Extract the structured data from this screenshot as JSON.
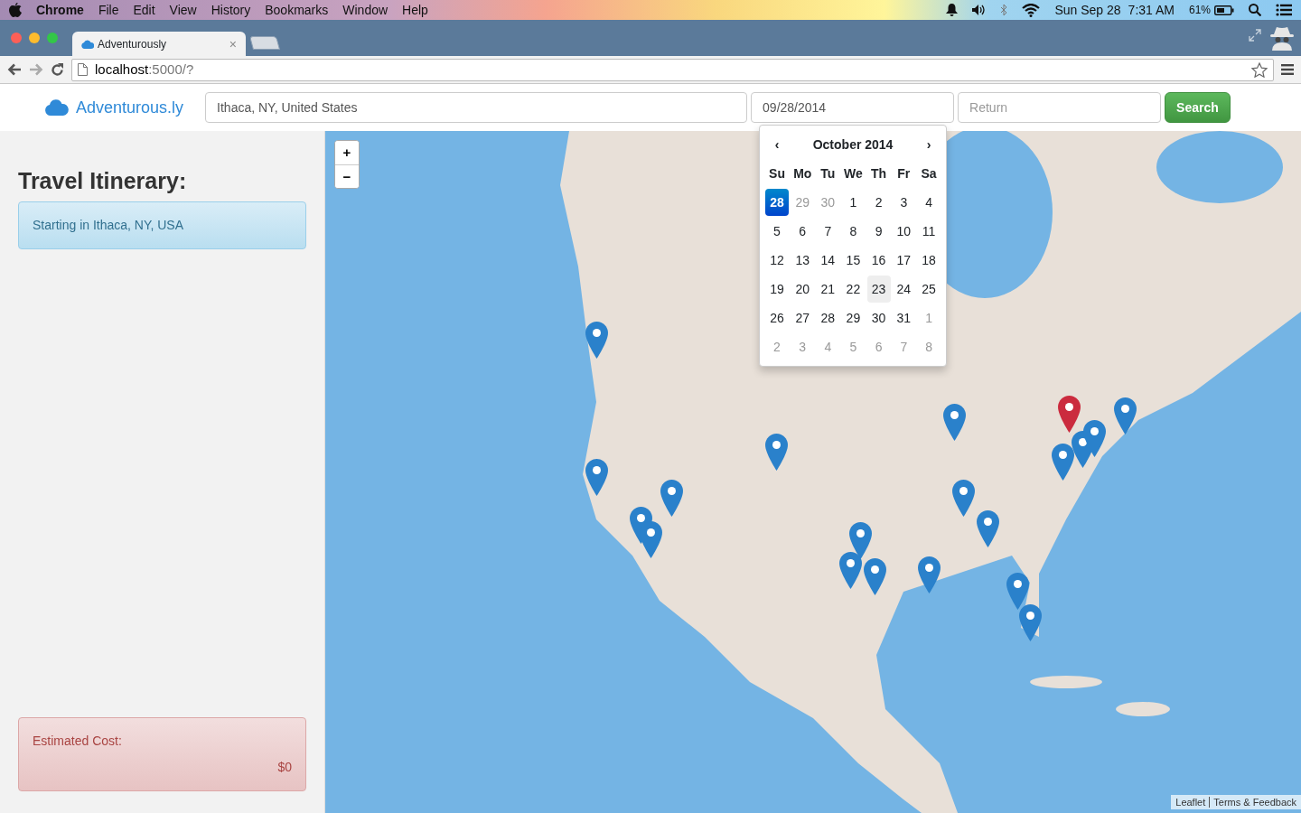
{
  "menubar": {
    "app": "Chrome",
    "menus": [
      "File",
      "Edit",
      "View",
      "History",
      "Bookmarks",
      "Window",
      "Help"
    ],
    "date": "Sun Sep 28",
    "time": "7:31 AM",
    "battery": "61%"
  },
  "browser": {
    "tab": {
      "title": "Adventurously",
      "close": "×"
    },
    "url_host": "localhost",
    "url_path": ":5000/?"
  },
  "app": {
    "brand": "Adventurous.ly",
    "origin": {
      "value": "Ithaca, NY, United States"
    },
    "depart": {
      "value": "09/28/2014"
    },
    "return": {
      "placeholder": "Return"
    },
    "search_button": "Search"
  },
  "datepicker": {
    "prev": "‹",
    "title": "October 2014",
    "next": "›",
    "weekdays": [
      "Su",
      "Mo",
      "Tu",
      "We",
      "Th",
      "Fr",
      "Sa"
    ],
    "weeks": [
      [
        {
          "day": "28",
          "other_month": true,
          "selected": true,
          "hovered": false
        },
        {
          "day": "29",
          "other_month": true,
          "selected": false,
          "hovered": false
        },
        {
          "day": "30",
          "other_month": true,
          "selected": false,
          "hovered": false
        },
        {
          "day": "1",
          "other_month": false,
          "selected": false,
          "hovered": false
        },
        {
          "day": "2",
          "other_month": false,
          "selected": false,
          "hovered": false
        },
        {
          "day": "3",
          "other_month": false,
          "selected": false,
          "hovered": false
        },
        {
          "day": "4",
          "other_month": false,
          "selected": false,
          "hovered": false
        }
      ],
      [
        {
          "day": "5",
          "other_month": false,
          "selected": false,
          "hovered": false
        },
        {
          "day": "6",
          "other_month": false,
          "selected": false,
          "hovered": false
        },
        {
          "day": "7",
          "other_month": false,
          "selected": false,
          "hovered": false
        },
        {
          "day": "8",
          "other_month": false,
          "selected": false,
          "hovered": false
        },
        {
          "day": "9",
          "other_month": false,
          "selected": false,
          "hovered": false
        },
        {
          "day": "10",
          "other_month": false,
          "selected": false,
          "hovered": false
        },
        {
          "day": "11",
          "other_month": false,
          "selected": false,
          "hovered": false
        }
      ],
      [
        {
          "day": "12",
          "other_month": false,
          "selected": false,
          "hovered": false
        },
        {
          "day": "13",
          "other_month": false,
          "selected": false,
          "hovered": false
        },
        {
          "day": "14",
          "other_month": false,
          "selected": false,
          "hovered": false
        },
        {
          "day": "15",
          "other_month": false,
          "selected": false,
          "hovered": false
        },
        {
          "day": "16",
          "other_month": false,
          "selected": false,
          "hovered": false
        },
        {
          "day": "17",
          "other_month": false,
          "selected": false,
          "hovered": false
        },
        {
          "day": "18",
          "other_month": false,
          "selected": false,
          "hovered": false
        }
      ],
      [
        {
          "day": "19",
          "other_month": false,
          "selected": false,
          "hovered": false
        },
        {
          "day": "20",
          "other_month": false,
          "selected": false,
          "hovered": false
        },
        {
          "day": "21",
          "other_month": false,
          "selected": false,
          "hovered": false
        },
        {
          "day": "22",
          "other_month": false,
          "selected": false,
          "hovered": false
        },
        {
          "day": "23",
          "other_month": false,
          "selected": false,
          "hovered": true
        },
        {
          "day": "24",
          "other_month": false,
          "selected": false,
          "hovered": false
        },
        {
          "day": "25",
          "other_month": false,
          "selected": false,
          "hovered": false
        }
      ],
      [
        {
          "day": "26",
          "other_month": false,
          "selected": false,
          "hovered": false
        },
        {
          "day": "27",
          "other_month": false,
          "selected": false,
          "hovered": false
        },
        {
          "day": "28",
          "other_month": false,
          "selected": false,
          "hovered": false
        },
        {
          "day": "29",
          "other_month": false,
          "selected": false,
          "hovered": false
        },
        {
          "day": "30",
          "other_month": false,
          "selected": false,
          "hovered": false
        },
        {
          "day": "31",
          "other_month": false,
          "selected": false,
          "hovered": false
        },
        {
          "day": "1",
          "other_month": true,
          "selected": false,
          "hovered": false
        }
      ],
      [
        {
          "day": "2",
          "other_month": true,
          "selected": false,
          "hovered": false
        },
        {
          "day": "3",
          "other_month": true,
          "selected": false,
          "hovered": false
        },
        {
          "day": "4",
          "other_month": true,
          "selected": false,
          "hovered": false
        },
        {
          "day": "5",
          "other_month": true,
          "selected": false,
          "hovered": false
        },
        {
          "day": "6",
          "other_month": true,
          "selected": false,
          "hovered": false
        },
        {
          "day": "7",
          "other_month": true,
          "selected": false,
          "hovered": false
        },
        {
          "day": "8",
          "other_month": true,
          "selected": false,
          "hovered": false
        }
      ]
    ]
  },
  "sidebar": {
    "title": "Travel Itinerary:",
    "itinerary": [
      "Starting in Ithaca, NY, USA"
    ],
    "cost_label": "Estimated Cost:",
    "cost": "$0"
  },
  "map": {
    "zoom_in": "+",
    "zoom_out": "−",
    "markers": [
      {
        "color": "#2a81cb"
      },
      {
        "color": "#2a81cb"
      },
      {
        "color": "#2a81cb"
      },
      {
        "color": "#2a81cb"
      },
      {
        "color": "#2a81cb"
      },
      {
        "color": "#2a81cb"
      },
      {
        "color": "#2a81cb"
      },
      {
        "color": "#2a81cb"
      },
      {
        "color": "#2a81cb"
      },
      {
        "color": "#2a81cb"
      },
      {
        "color": "#2a81cb"
      },
      {
        "color": "#2a81cb"
      },
      {
        "color": "#2a81cb"
      },
      {
        "color": "#2a81cb"
      },
      {
        "color": "#2a81cb"
      },
      {
        "color": "#2a81cb"
      },
      {
        "color": "#2a81cb"
      },
      {
        "color": "#2a81cb"
      },
      {
        "color": "#2a81cb"
      },
      {
        "color": "#cb2b3e"
      }
    ],
    "attribution": [
      "Leaflet",
      "Terms & Feedback"
    ]
  }
}
